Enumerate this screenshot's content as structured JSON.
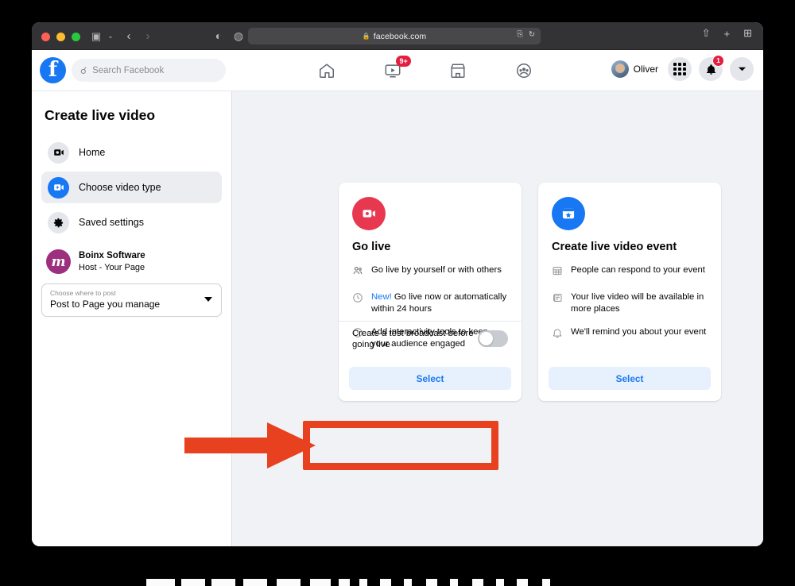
{
  "browser": {
    "traffic_lights": [
      "close",
      "minimize",
      "maximize"
    ],
    "sidebar_toggle_icon": "▣",
    "sidebar_chevron_icon": "⌄",
    "back_icon": "‹",
    "forward_icon": "›",
    "shield_icon": "◐",
    "extension_icon": "◍",
    "url": "facebook.com",
    "lock_icon": "🔒",
    "reader_icon": "⎘",
    "reload_icon": "↻",
    "share_icon": "⇧",
    "newtab_icon": "+",
    "tabs_overview_icon": "⊞"
  },
  "fb_topbar": {
    "logo_letter": "f",
    "search": {
      "placeholder": "Search Facebook",
      "icon": "search-icon"
    },
    "nav_tabs": [
      {
        "name": "home",
        "icon": "home-icon",
        "badge": ""
      },
      {
        "name": "video",
        "icon": "video-icon",
        "badge": "9+"
      },
      {
        "name": "marketplace",
        "icon": "marketplace-icon",
        "badge": ""
      },
      {
        "name": "groups",
        "icon": "groups-icon",
        "badge": ""
      }
    ],
    "profile_name": "Oliver",
    "menu_icon": "grid-icon",
    "notifications_icon": "bell-icon",
    "notifications_badge": "1",
    "account_icon": "chevron-down-icon"
  },
  "sidebar": {
    "title": "Create live video",
    "items": [
      {
        "label": "Home",
        "icon": "video-camera-icon",
        "active": false
      },
      {
        "label": "Choose video type",
        "icon": "add-video-icon",
        "active": true
      },
      {
        "label": "Saved settings",
        "icon": "gear-icon",
        "active": false
      }
    ],
    "page": {
      "name": "Boinx Software",
      "role": "Host - Your Page",
      "avatar_letter": "m"
    },
    "where_to_post": {
      "label": "Choose where to post",
      "value": "Post to Page you manage",
      "caret_icon": "caret-down-icon"
    }
  },
  "cards": [
    {
      "id": "go-live",
      "icon": "video-camera-icon",
      "icon_color": "#e8384f",
      "title": "Go live",
      "features": [
        {
          "icon": "people-icon",
          "prefix": "",
          "text": "Go live by yourself or with others"
        },
        {
          "icon": "clock-icon",
          "prefix": "New!",
          "text": "Go live now or automatically within 24 hours"
        },
        {
          "icon": "clock-icon",
          "prefix": "",
          "text": "Add interactivity tools to keep your audience engaged"
        }
      ],
      "toggle": {
        "label": "Create a test broadcast before going live",
        "state": "off"
      },
      "select_label": "Select"
    },
    {
      "id": "live-event",
      "icon": "event-star-icon",
      "icon_color": "#1877f2",
      "title": "Create live video event",
      "features": [
        {
          "icon": "calendar-grid-icon",
          "prefix": "",
          "text": "People can respond to your event"
        },
        {
          "icon": "news-icon",
          "prefix": "",
          "text": "Your live video will be available in more places"
        },
        {
          "icon": "bell-icon",
          "prefix": "",
          "text": "We'll remind you about your event"
        }
      ],
      "select_label": "Select"
    }
  ],
  "annotation": {
    "color": "#e8411f",
    "shape": "arrow-and-rectangle",
    "target": "go-live-select-button"
  }
}
